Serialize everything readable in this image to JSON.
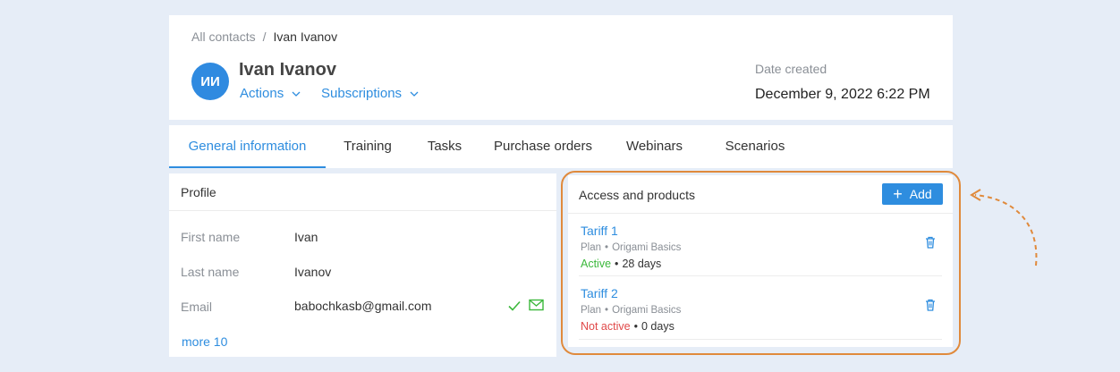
{
  "breadcrumb": {
    "root": "All contacts",
    "separator": "/",
    "current": "Ivan Ivanov"
  },
  "contact": {
    "initials": "ИИ",
    "name": "Ivan Ivanov",
    "actions_label": "Actions",
    "subscriptions_label": "Subscriptions",
    "date_label": "Date created",
    "date_value": "December 9, 2022 6:22 PM"
  },
  "tabs": [
    {
      "label": "General information",
      "active": true
    },
    {
      "label": "Training"
    },
    {
      "label": "Tasks"
    },
    {
      "label": "Purchase orders"
    },
    {
      "label": "Webinars"
    },
    {
      "label": "Scenarios"
    }
  ],
  "profile": {
    "title": "Profile",
    "fields": [
      {
        "label": "First name",
        "value": "Ivan"
      },
      {
        "label": "Last name",
        "value": "Ivanov"
      },
      {
        "label": "Email",
        "value": "babochkasb@gmail.com"
      }
    ],
    "more_label": "more 10"
  },
  "access": {
    "title": "Access and products",
    "add_label": "Add",
    "tariffs": [
      {
        "name": "Tariff 1",
        "plan_label": "Plan",
        "plan_name": "Origami Basics",
        "status": "Active",
        "duration": "28 days"
      },
      {
        "name": "Tariff 2",
        "plan_label": "Plan",
        "plan_name": "Origami Basics",
        "status": "Not active",
        "duration": "0 days"
      }
    ]
  },
  "colors": {
    "accent": "#2e8ddf",
    "active": "#3cb83c",
    "inactive": "#e04848",
    "highlight": "#e08a3c",
    "background": "#e6edf7"
  }
}
